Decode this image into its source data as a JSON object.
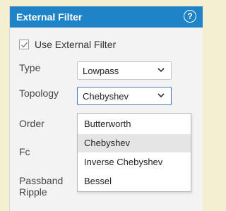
{
  "panel": {
    "title": "External Filter",
    "help_icon": "?"
  },
  "use_external_filter": {
    "label": "Use External Filter",
    "checked": true
  },
  "fields": {
    "type": {
      "label": "Type",
      "value": "Lowpass"
    },
    "topology": {
      "label": "Topology",
      "value": "Chebyshev"
    },
    "order": {
      "label": "Order"
    },
    "fc": {
      "label": "Fc"
    },
    "passband_ripple": {
      "label_line1": "Passband",
      "label_line2": "Ripple"
    }
  },
  "topology_dropdown": {
    "options": [
      "Butterworth",
      "Chebyshev",
      "Inverse Chebyshev",
      "Bessel"
    ],
    "selected_index": 1
  },
  "colors": {
    "header": "#1f83c8",
    "panel_background": "#f3f3f3",
    "page_background": "#f4efd1",
    "focus_border": "#4a78c8",
    "selected_option": "#e5e5e5"
  }
}
